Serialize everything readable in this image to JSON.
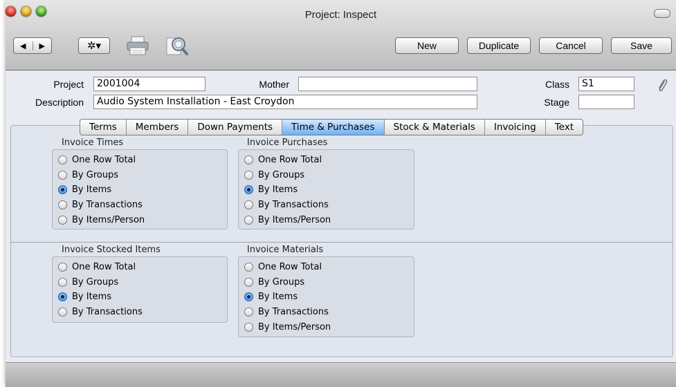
{
  "window": {
    "title": "Project: Inspect"
  },
  "toolbar": {
    "prev_glyph": "◀",
    "next_glyph": "▶",
    "gear_glyph": "✲▾",
    "icons": [
      "printer-icon",
      "search-icon"
    ],
    "buttons": {
      "new": "New",
      "duplicate": "Duplicate",
      "cancel": "Cancel",
      "save": "Save"
    }
  },
  "form": {
    "project_label": "Project",
    "project_value": "2001004",
    "mother_label": "Mother",
    "mother_value": "",
    "class_label": "Class",
    "class_value": "S1",
    "description_label": "Description",
    "description_value": "Audio System Installation - East Croydon",
    "stage_label": "Stage",
    "stage_value": ""
  },
  "tabs": [
    "Terms",
    "Members",
    "Down Payments",
    "Time & Purchases",
    "Stock & Materials",
    "Invoicing",
    "Text"
  ],
  "active_tab": "Time & Purchases",
  "groups": {
    "invoice_times": {
      "title": "Invoice Times",
      "options": [
        "One Row Total",
        "By Groups",
        "By Items",
        "By Transactions",
        "By Items/Person"
      ],
      "selected": "By Items"
    },
    "invoice_purchases": {
      "title": "Invoice Purchases",
      "options": [
        "One Row Total",
        "By Groups",
        "By Items",
        "By Transactions",
        "By Items/Person"
      ],
      "selected": "By Items"
    },
    "invoice_stocked_items": {
      "title": "Invoice Stocked Items",
      "options": [
        "One Row Total",
        "By Groups",
        "By Items",
        "By Transactions"
      ],
      "selected": "By Items"
    },
    "invoice_materials": {
      "title": "Invoice Materials",
      "options": [
        "One Row Total",
        "By Groups",
        "By Items",
        "By Transactions",
        "By Items/Person"
      ],
      "selected": "By Items"
    }
  },
  "colors": {
    "active_tab": "#6fb1f5",
    "radio_selected": "#2d7fe0"
  }
}
